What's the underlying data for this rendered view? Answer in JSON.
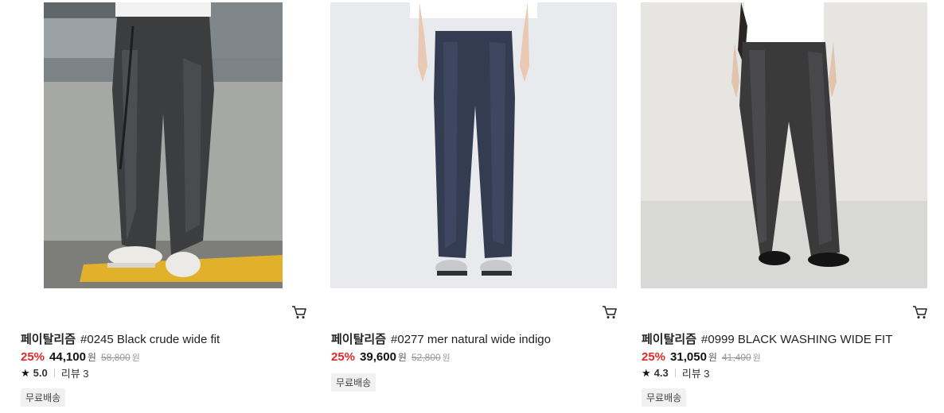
{
  "products": [
    {
      "brand": "페이탈리즘",
      "name": "#0245 Black crude wide fit",
      "discount": "25%",
      "sale_price": "44,100",
      "original_price": "58,800",
      "currency": "원",
      "rating": "5.0",
      "review_label": "리뷰 3",
      "badge": "무료배송",
      "icons": {
        "cart": "cart-icon",
        "star": "star-icon"
      }
    },
    {
      "brand": "페이탈리즘",
      "name": "#0277 mer natural wide indigo",
      "discount": "25%",
      "sale_price": "39,600",
      "original_price": "52,800",
      "currency": "원",
      "badge": "무료배송",
      "icons": {
        "cart": "cart-icon"
      }
    },
    {
      "brand": "페이탈리즘",
      "name": "#0999 BLACK WASHING WIDE FIT",
      "discount": "25%",
      "sale_price": "31,050",
      "original_price": "41,400",
      "currency": "원",
      "rating": "4.3",
      "review_label": "리뷰 3",
      "badge": "무료배송",
      "icons": {
        "cart": "cart-icon",
        "star": "star-icon"
      }
    }
  ],
  "colors": {
    "discount": "#e0292a",
    "badge_bg": "#f1f1f1"
  }
}
